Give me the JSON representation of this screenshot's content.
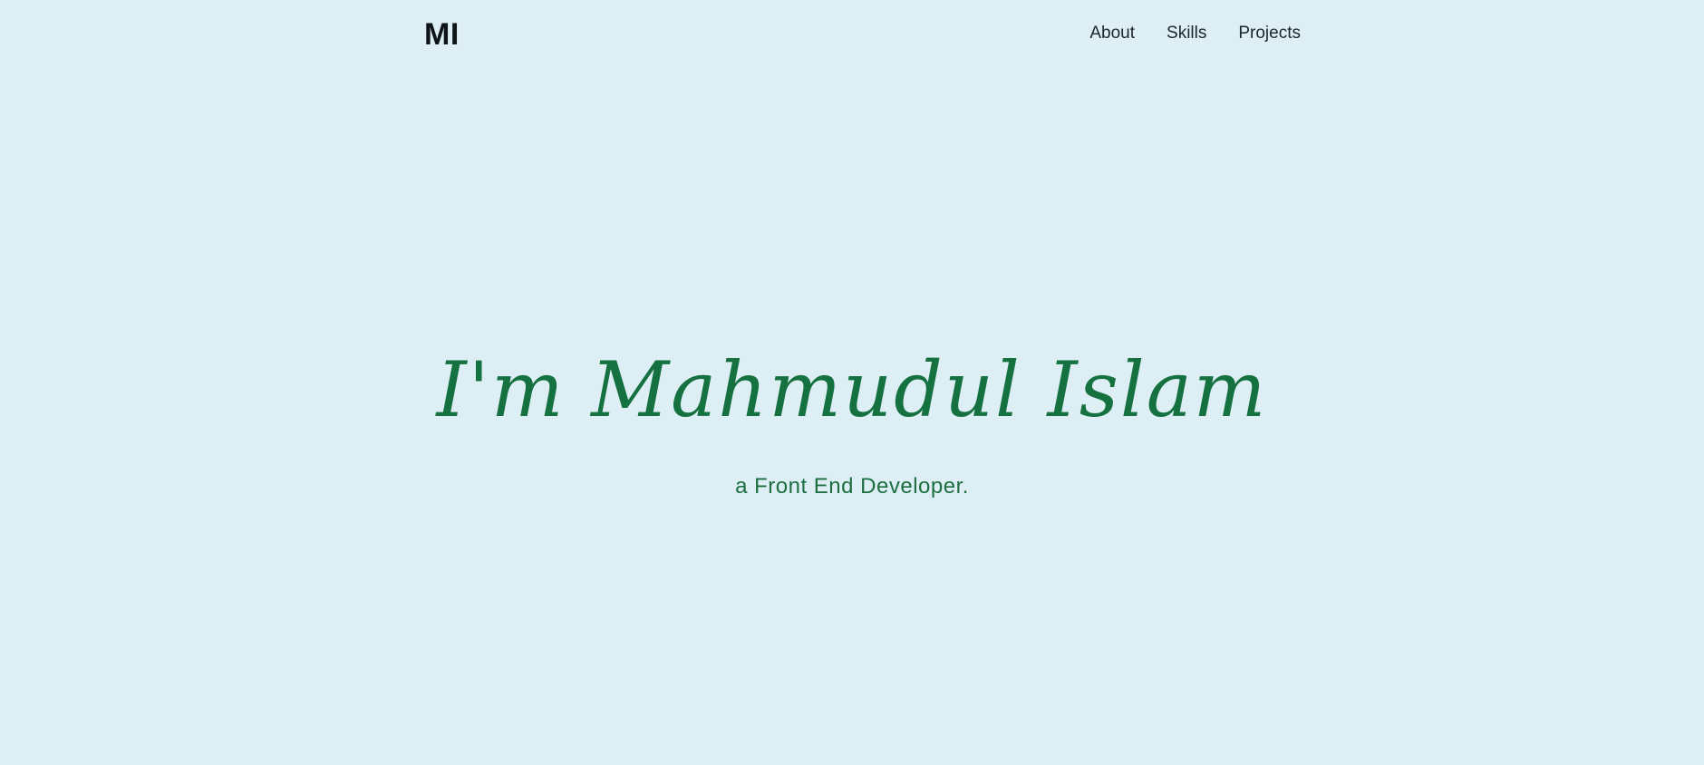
{
  "brand": {
    "logo_text": "MI"
  },
  "nav": {
    "items": [
      {
        "label": "About"
      },
      {
        "label": "Skills"
      },
      {
        "label": "Projects"
      }
    ]
  },
  "hero": {
    "heading": "I'm Mahmudul Islam",
    "subheading": "a Front End Developer."
  },
  "theme": {
    "background": "#ddeef4",
    "accent": "#157140",
    "text": "#1c2430"
  }
}
